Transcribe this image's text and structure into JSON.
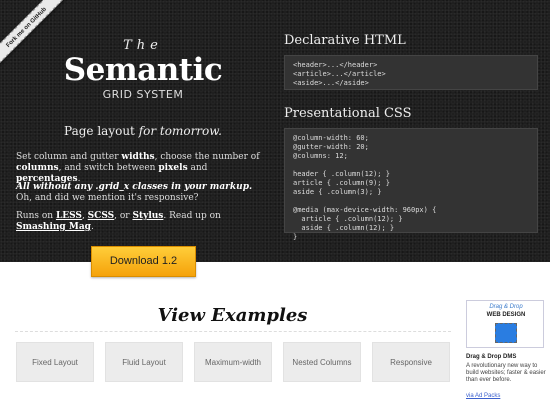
{
  "ribbon": {
    "label": "Fork me on GitHub"
  },
  "header": {
    "title_small": "The",
    "title_main": "Semantic",
    "title_sub": "GRID SYSTEM",
    "tagline_plain": "Page layout ",
    "tagline_em": "for tomorrow."
  },
  "description": {
    "p1": [
      "Set column and gutter ",
      "widths",
      ", choose the number of ",
      "columns",
      ", and switch between ",
      "pixels",
      " and ",
      "percentages",
      "."
    ],
    "p2": [
      "All without any .grid_x classes in your markup.",
      " Oh, and did we mention it's responsive?"
    ],
    "p3": [
      "Runs on ",
      "LESS",
      ", ",
      "SCSS",
      ", or ",
      "Stylus",
      ". Read up on ",
      "Smashing Mag",
      "."
    ]
  },
  "code": {
    "html_title": "Declarative HTML",
    "html_lines": [
      "<header>...</header>",
      "<article>...</article>",
      "<aside>...</aside>"
    ],
    "css_title": "Presentational CSS",
    "css_lines": [
      "@column-width: 60;",
      "@gutter-width: 20;",
      "@columns: 12;",
      "",
      "header { .column(12); }",
      "article { .column(9); }",
      "aside { .column(3); }",
      "",
      "@media (max-device-width: 960px) {",
      "  article { .column(12); }",
      "  aside { .column(12); }",
      "}"
    ]
  },
  "download": {
    "label": "Download 1.2"
  },
  "examples": {
    "title": "View Examples",
    "items": [
      "Fixed Layout",
      "Fluid Layout",
      "Maximum-width",
      "Nested Columns",
      "Responsive"
    ]
  },
  "ad": {
    "head": "Drag & Drop",
    "sub": "WEB DESIGN",
    "title": "Drag & Drop DMS",
    "text": "A revolutionary new way to build websites; faster & easier than ever before.",
    "via": "via Ad Packs"
  }
}
